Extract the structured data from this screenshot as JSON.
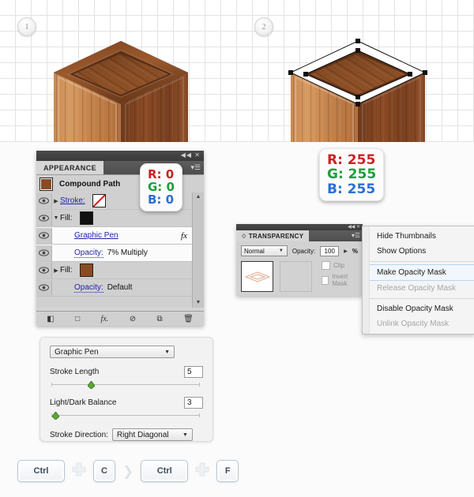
{
  "canvas": {
    "step1_badge": "1",
    "step2_badge": "2"
  },
  "appearance_panel": {
    "tab_label": "APPEARANCE",
    "collapse_icon": "◀◀",
    "close_icon": "✕",
    "menu_icon": "menu-icon",
    "object_type": "Compound Path",
    "rows": [
      {
        "label": "Stroke:",
        "swatch": "none",
        "value": ""
      },
      {
        "label": "Fill:",
        "swatch": "black",
        "value": ""
      },
      {
        "label": "Graphic Pen",
        "swatch": "",
        "value": "",
        "fx": "fx"
      },
      {
        "label": "Opacity:",
        "swatch": "",
        "value": "7% Multiply"
      },
      {
        "label": "Fill:",
        "swatch": "brown",
        "value": ""
      },
      {
        "label": "Opacity:",
        "swatch": "",
        "value": "Default"
      }
    ],
    "footer_icons": [
      "add-new-stroke",
      "add-new-fill",
      "add-new-effect",
      "clear-appearance",
      "duplicate-item",
      "delete-item"
    ]
  },
  "callouts": {
    "black": {
      "r": "R: 0",
      "g": "G: 0",
      "b": "B: 0"
    },
    "white": {
      "r": "R: 255",
      "g": "G: 255",
      "b": "B: 255"
    }
  },
  "transparency_panel": {
    "tab_label": "TRANSPARENCY",
    "blend_mode": "Normal",
    "opacity_label": "Opacity:",
    "opacity_value": "100",
    "percent_symbol": "%",
    "clip_label": "Clip",
    "invert_mask_label": "Invert Mask"
  },
  "context_menu": {
    "items": [
      {
        "label": "Hide Thumbnails",
        "state": "normal"
      },
      {
        "label": "Show Options",
        "state": "normal"
      },
      {
        "label": "Make Opacity Mask",
        "state": "highlight"
      },
      {
        "label": "Release Opacity Mask",
        "state": "disabled"
      },
      {
        "label": "Disable Opacity Mask",
        "state": "normal-dim"
      },
      {
        "label": "Unlink Opacity Mask",
        "state": "disabled"
      }
    ]
  },
  "graphic_pen_dialog": {
    "effect_name": "Graphic Pen",
    "stroke_length_label": "Stroke Length",
    "stroke_length_value": "5",
    "light_dark_label": "Light/Dark Balance",
    "light_dark_value": "3",
    "stroke_direction_label": "Stroke Direction:",
    "stroke_direction_value": "Right Diagonal"
  },
  "shortcuts": {
    "key1": "Ctrl",
    "plus1": "+",
    "key2": "C",
    "then": "❯",
    "key3": "Ctrl",
    "plus2": "+",
    "key4": "F"
  }
}
